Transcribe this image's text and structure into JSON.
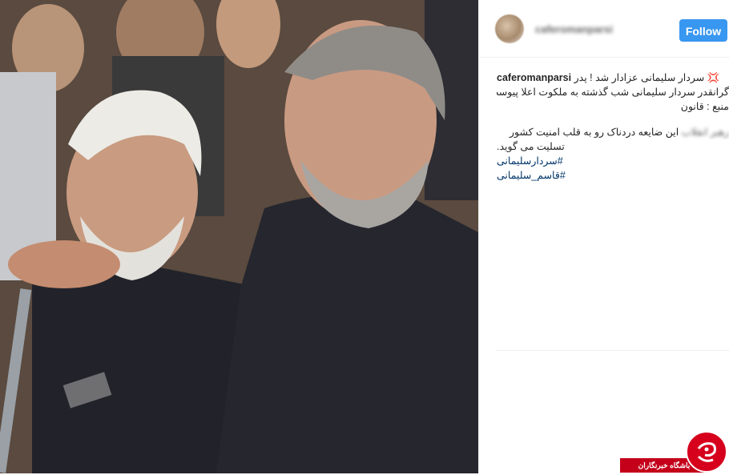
{
  "post": {
    "username_blurred": "caferomanparsi",
    "follow_label": "Follow"
  },
  "caption": {
    "author": "caferomanparsi",
    "line1_text": "سردار سلیمانی عزادار شد ! پدر 💢",
    "line2": "گرانقدر سردار سلیمانی شب گذشته به ملکوت اعلا پیوست",
    "line3": "منبع : قانون",
    "line4_blurred": "رهبر انقلاب",
    "line4_text": "این ضایعه دردناک رو به قلب امنیت کشور",
    "line5": ".تسلیت می گوید",
    "hashtags": [
      "#سردارسلیمانی",
      "#قاسم_سلیمانی"
    ]
  },
  "watermark": {
    "label": "باشگاه خبرنگاران"
  },
  "colors": {
    "follow_button": "#3897f0",
    "hashtag": "#003569",
    "watermark_red": "#d6001c"
  }
}
